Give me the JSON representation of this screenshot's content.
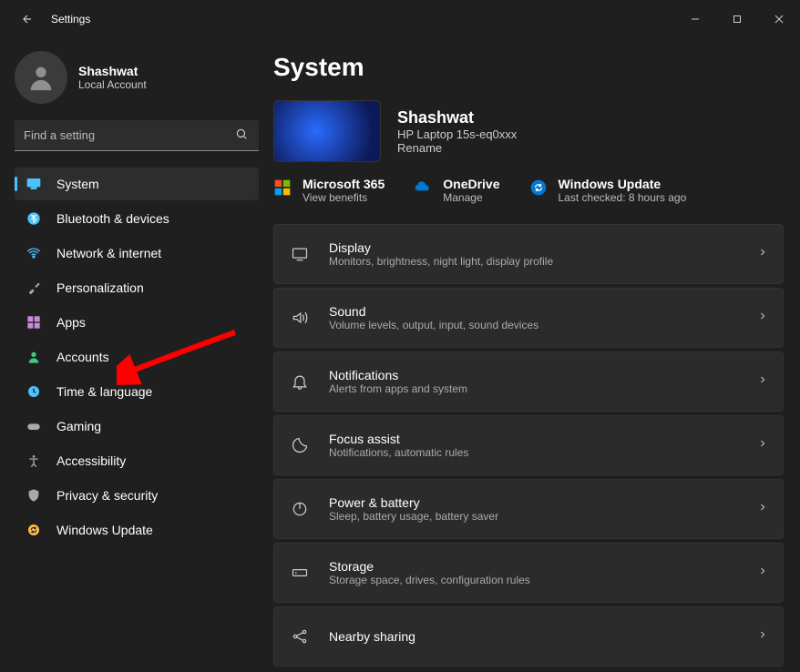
{
  "window": {
    "title": "Settings"
  },
  "user": {
    "name": "Shashwat",
    "account_type": "Local Account"
  },
  "search": {
    "placeholder": "Find a setting"
  },
  "nav": [
    {
      "label": "System",
      "icon": "🖥️",
      "color": "#4cc2ff",
      "active": true,
      "name": "system"
    },
    {
      "label": "Bluetooth & devices",
      "icon": "bt",
      "color": "#4cc2ff",
      "name": "bluetooth-devices"
    },
    {
      "label": "Network & internet",
      "icon": "wifi",
      "color": "#4cc2ff",
      "name": "network-internet"
    },
    {
      "label": "Personalization",
      "icon": "brush",
      "color": "#aaa",
      "name": "personalization"
    },
    {
      "label": "Apps",
      "icon": "apps",
      "color": "#c98bdb",
      "name": "apps"
    },
    {
      "label": "Accounts",
      "icon": "person",
      "color": "#3ec97e",
      "name": "accounts"
    },
    {
      "label": "Time & language",
      "icon": "clock",
      "color": "#4cc2ff",
      "name": "time-language"
    },
    {
      "label": "Gaming",
      "icon": "game",
      "color": "#aaa",
      "name": "gaming"
    },
    {
      "label": "Accessibility",
      "icon": "access",
      "color": "#aaa",
      "name": "accessibility"
    },
    {
      "label": "Privacy & security",
      "icon": "shield",
      "color": "#aaa",
      "name": "privacy-security"
    },
    {
      "label": "Windows Update",
      "icon": "update",
      "color": "#ffb84d",
      "name": "windows-update"
    }
  ],
  "page": {
    "title": "System",
    "device": {
      "name": "Shashwat",
      "model": "HP Laptop 15s-eq0xxx",
      "rename": "Rename"
    },
    "services": {
      "ms365": {
        "title": "Microsoft 365",
        "sub": "View benefits"
      },
      "onedrive": {
        "title": "OneDrive",
        "sub": "Manage"
      },
      "winupd": {
        "title": "Windows Update",
        "sub": "Last checked: 8 hours ago"
      }
    },
    "cards": [
      {
        "title": "Display",
        "sub": "Monitors, brightness, night light, display profile",
        "icon": "display",
        "name": "display"
      },
      {
        "title": "Sound",
        "sub": "Volume levels, output, input, sound devices",
        "icon": "sound",
        "name": "sound"
      },
      {
        "title": "Notifications",
        "sub": "Alerts from apps and system",
        "icon": "bell",
        "name": "notifications"
      },
      {
        "title": "Focus assist",
        "sub": "Notifications, automatic rules",
        "icon": "moon",
        "name": "focus-assist"
      },
      {
        "title": "Power & battery",
        "sub": "Sleep, battery usage, battery saver",
        "icon": "power",
        "name": "power-battery"
      },
      {
        "title": "Storage",
        "sub": "Storage space, drives, configuration rules",
        "icon": "storage",
        "name": "storage"
      },
      {
        "title": "Nearby sharing",
        "sub": "",
        "icon": "share",
        "name": "nearby-sharing"
      }
    ]
  }
}
